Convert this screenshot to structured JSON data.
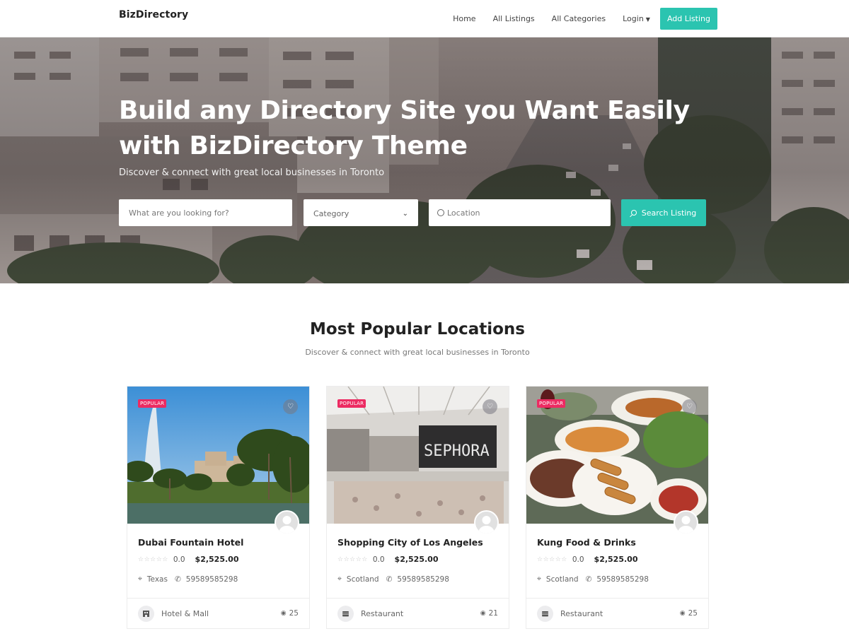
{
  "header": {
    "logo": "BizDirectory",
    "nav": [
      "Home",
      "All Listings",
      "All Categories",
      "Login"
    ],
    "add_listing": "Add Listing"
  },
  "hero": {
    "title_line1": "Build any Directory Site you Want Easily",
    "title_line2": "with BizDirectory Theme",
    "subtitle": "Discover & connect with great local businesses in Toronto",
    "search_placeholder": "What are you looking for?",
    "category_value": "Category",
    "location_placeholder": "Location",
    "search_button": "Search Listing"
  },
  "section": {
    "title": "Most Popular Locations",
    "subtitle": "Discover & connect with great local businesses in Toronto"
  },
  "listings": [
    {
      "badge": "POPULAR",
      "name": "Dubai Fountain Hotel",
      "rating": "0.0",
      "price": "$2,525.00",
      "location": "Texas",
      "phone": "59589585298",
      "category": "Hotel & Mall",
      "views": "25"
    },
    {
      "badge": "POPULAR",
      "name": "Shopping City of Los Angeles",
      "rating": "0.0",
      "price": "$2,525.00",
      "location": "Scotland",
      "phone": "59589585298",
      "category": "Restaurant",
      "views": "21"
    },
    {
      "badge": "POPULAR",
      "name": "Kung Food & Drinks",
      "rating": "0.0",
      "price": "$2,525.00",
      "location": "Scotland",
      "phone": "59589585298",
      "category": "Restaurant",
      "views": "25"
    }
  ],
  "colors": {
    "accent": "#2bc4b0",
    "badge": "#ec2b62"
  }
}
